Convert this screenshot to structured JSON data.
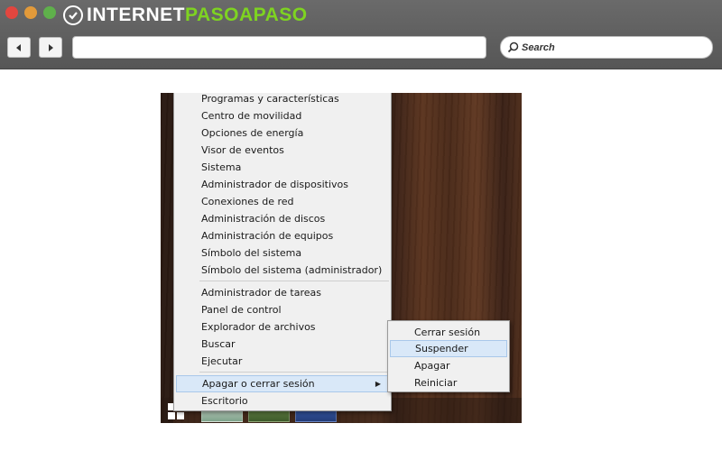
{
  "browser": {
    "logo_text_prefix": "INTERNET",
    "logo_text_accent": "PASOAPASO",
    "search_placeholder": "Search",
    "accent_color": "#7ed321"
  },
  "menu": {
    "items": [
      {
        "label": "Programas y características"
      },
      {
        "label": "Centro de movilidad"
      },
      {
        "label": "Opciones de energía"
      },
      {
        "label": "Visor de eventos"
      },
      {
        "label": "Sistema"
      },
      {
        "label": "Administrador de dispositivos"
      },
      {
        "label": "Conexiones de red"
      },
      {
        "label": "Administración de discos"
      },
      {
        "label": "Administración de equipos"
      },
      {
        "label": "Símbolo del sistema"
      },
      {
        "label": "Símbolo del sistema (administrador)"
      },
      {
        "label": "Administrador de tareas"
      },
      {
        "label": "Panel de control"
      },
      {
        "label": "Explorador de archivos"
      },
      {
        "label": "Buscar"
      },
      {
        "label": "Ejecutar"
      },
      {
        "label": "Apagar o cerrar sesión"
      },
      {
        "label": "Escritorio"
      }
    ],
    "highlighted": "Apagar o cerrar sesión",
    "highlight_color": "#d9e8f8"
  },
  "submenu": {
    "items": [
      {
        "label": "Cerrar sesión"
      },
      {
        "label": "Suspender"
      },
      {
        "label": "Apagar"
      },
      {
        "label": "Reiniciar"
      }
    ],
    "highlighted": "Suspender"
  }
}
